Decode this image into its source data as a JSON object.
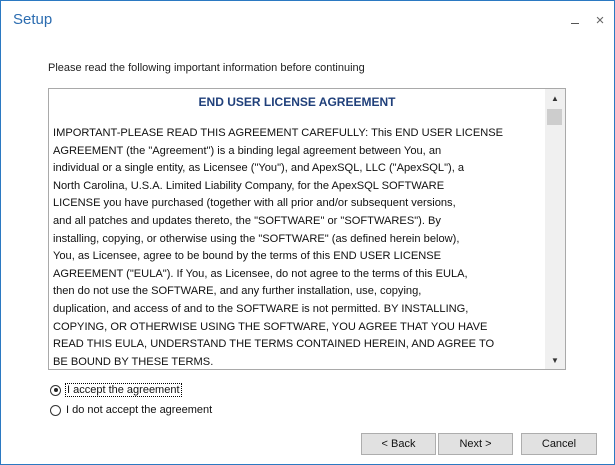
{
  "window": {
    "title": "Setup",
    "minimize_glyph": "minimize-icon",
    "close_glyph": "×"
  },
  "intro": "Please read the following important information before continuing",
  "eula": {
    "title": "END USER LICENSE AGREEMENT",
    "lines": [
      "IMPORTANT-PLEASE READ THIS AGREEMENT CAREFULLY: This END USER LICENSE",
      "AGREEMENT (the \"Agreement\") is a binding legal agreement between You, an",
      "individual or a single entity, as Licensee (\"You\"), and ApexSQL, LLC (\"ApexSQL\"), a",
      "North Carolina, U.S.A. Limited Liability Company, for the ApexSQL SOFTWARE",
      "LICENSE you have purchased (together with all prior and/or subsequent versions,",
      "and all patches and updates thereto, the \"SOFTWARE\" or \"SOFTWARES\").   By",
      "installing, copying, or otherwise using the \"SOFTWARE\" (as defined herein below),",
      "You, as Licensee, agree to be bound by the terms of this END USER LICENSE",
      "AGREEMENT (\"EULA\"). If You, as Licensee, do not agree to the terms of this EULA,",
      "then do not use the SOFTWARE, and any further installation, use, copying,",
      "duplication, and access of and to the SOFTWARE is not permitted.  BY INSTALLING,",
      "COPYING, OR OTHERWISE USING THE SOFTWARE, YOU AGREE THAT YOU HAVE",
      "READ THIS EULA, UNDERSTAND THE TERMS CONTAINED HEREIN, AND AGREE TO",
      "BE BOUND BY THESE TERMS."
    ]
  },
  "options": {
    "accept": "I accept the agreement",
    "decline": "I do not accept the agreement",
    "selected": "accept"
  },
  "buttons": {
    "back": "< Back",
    "next": "Next >",
    "cancel": "Cancel"
  },
  "colors": {
    "title": "#2b6cb0",
    "border": "#2b79c2",
    "eula_title": "#1f3f7a"
  }
}
